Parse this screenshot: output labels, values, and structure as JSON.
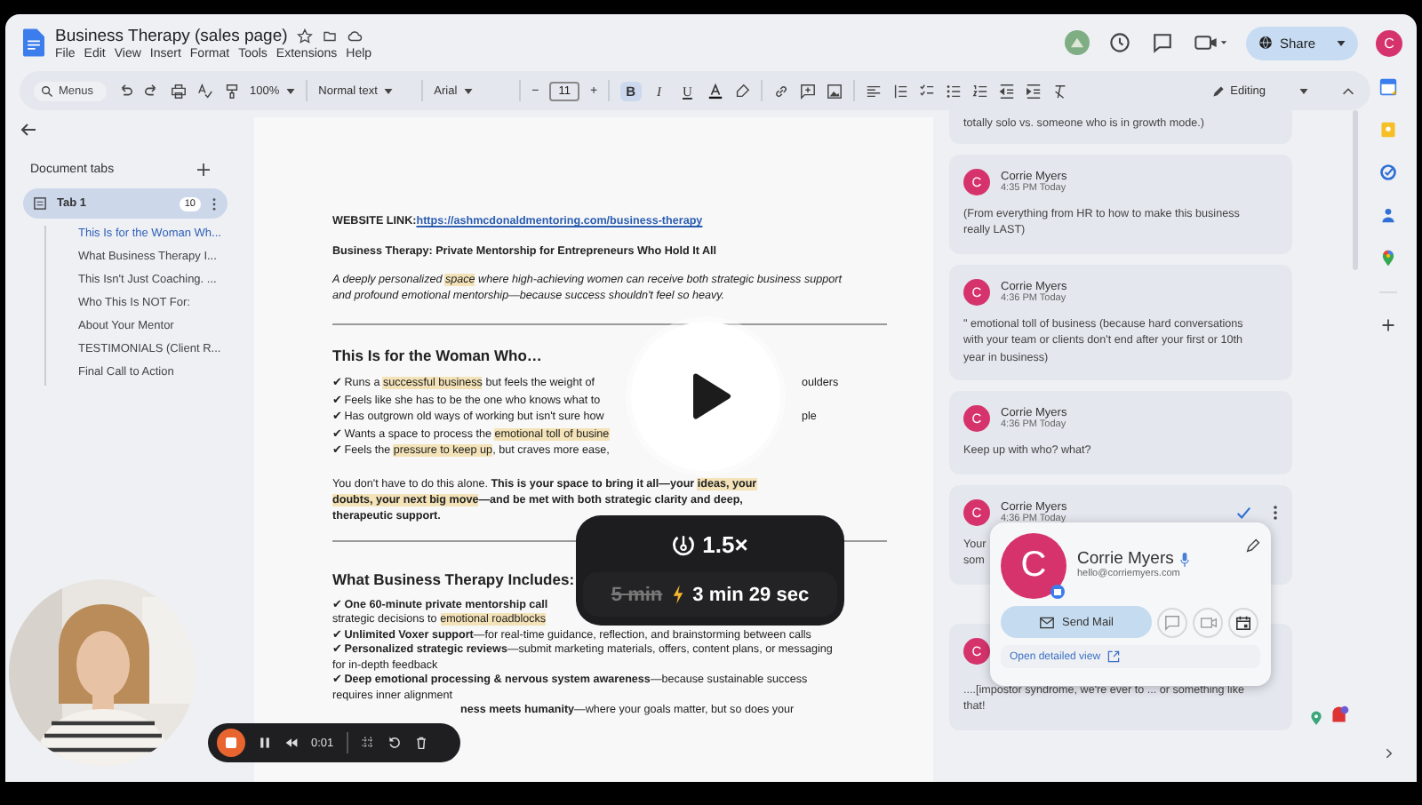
{
  "doc_title": "Business Therapy (sales page)",
  "menu": [
    "File",
    "Edit",
    "View",
    "Insert",
    "Format",
    "Tools",
    "Extensions",
    "Help"
  ],
  "share_label": "Share",
  "account_initial": "C",
  "toolbar": {
    "search": "Menus",
    "zoom": "100%",
    "style": "Normal text",
    "font": "Arial",
    "size_minus": "−",
    "size": "11",
    "size_plus": "+",
    "mode": "Editing"
  },
  "format_buttons": [
    {
      "label": "B",
      "selected": true
    },
    {
      "label": "I",
      "selected": false
    },
    {
      "label": "U",
      "selected": false
    }
  ],
  "sidebar": {
    "title": "Document tabs",
    "tab": {
      "label": "Tab 1",
      "count": "10",
      "selected": true
    },
    "outline": [
      {
        "label": "This Is for the Woman Wh...",
        "selected": true
      },
      {
        "label": "What Business Therapy I...",
        "selected": false
      },
      {
        "label": "This Isn't Just Coaching. ...",
        "selected": false
      },
      {
        "label": "Who This Is NOT For:",
        "selected": false
      },
      {
        "label": "About Your Mentor",
        "selected": false
      },
      {
        "label": "TESTIMONIALS (Client R...",
        "selected": false
      },
      {
        "label": "Final Call to Action",
        "selected": false
      }
    ]
  },
  "document": [
    {
      "kind": "link",
      "label": "WEBSITE LINK:",
      "url": "https://ashmcdonaldmentoring.com/business-therapy"
    },
    {
      "kind": "title",
      "parts": [
        {
          "text": "Business Therapy: Private Mentorship for Entrepreneurs Who Hold It All",
          "hl": false
        }
      ]
    },
    {
      "kind": "intro",
      "parts": [
        {
          "text": "A deeply personalized ",
          "hl": false
        },
        {
          "text": "space",
          "hl": true
        },
        {
          "text": " where high-achieving women can receive both strategic business support and profound emotional mentorship—because success shouldn't feel so heavy.",
          "hl": false
        }
      ]
    },
    {
      "kind": "rule"
    },
    {
      "kind": "heading",
      "parts": [
        {
          "text": "This Is for the Woman Who…",
          "hl": false
        }
      ]
    },
    {
      "kind": "split",
      "parts": [
        {
          "text": "✔ Runs a ",
          "hl": false
        },
        {
          "text": "successful business",
          "hl": true
        },
        {
          "text": " but feels the weight of",
          "hl": false
        }
      ],
      "right": "oulders"
    },
    {
      "kind": "split",
      "parts": [
        {
          "text": "✔ Feels like she has to be the one who knows what to",
          "hl": false
        }
      ]
    },
    {
      "kind": "split",
      "parts": [
        {
          "text": "✔ Has outgrown old ways of working but isn't sure how",
          "hl": false
        }
      ],
      "right": "ple"
    },
    {
      "kind": "split",
      "parts": [
        {
          "text": "✔ Wants a space to process the ",
          "hl": false
        },
        {
          "text": "emotional toll of busine",
          "hl": true
        }
      ]
    },
    {
      "kind": "split",
      "parts": [
        {
          "text": "✔ Feels the ",
          "hl": false
        },
        {
          "text": "pressure to keep up",
          "hl": true
        },
        {
          "text": ", but craves more ease,",
          "hl": false
        }
      ]
    },
    {
      "kind": "para",
      "parts": [
        {
          "text": "You don't have to do this alone. **This is your space to bring it all—your** ",
          "hl": false
        },
        {
          "text": "**ideas, your doubts, your next big move**",
          "hl": true
        },
        {
          "text": "**—and be met with both strategic clarity and deep, therapeutic support.**",
          "hl": false
        }
      ]
    },
    {
      "kind": "rule"
    },
    {
      "kind": "heading",
      "parts": [
        {
          "text": "What Business Therapy Includes:",
          "hl": false
        }
      ]
    },
    {
      "kind": "line",
      "parts": [
        {
          "text": "✔ **One 60-minute private mentorship call**",
          "hl": false
        }
      ]
    },
    {
      "kind": "line",
      "parts": [
        {
          "text": "strategic decisions to ",
          "hl": false
        },
        {
          "text": "emotional roadblocks",
          "hl": true
        }
      ]
    },
    {
      "kind": "line",
      "parts": [
        {
          "text": "✔ **Unlimited Voxer support**—for real-time guidance, reflection, and brainstorming between calls",
          "hl": false
        }
      ]
    },
    {
      "kind": "line",
      "parts": [
        {
          "text": "✔ **Personalized strategic reviews**—submit marketing materials, offers, content plans, or messaging for in-depth feedback",
          "hl": false
        }
      ]
    },
    {
      "kind": "line",
      "parts": [
        {
          "text": "✔ **Deep emotional processing & nervous system awareness**—because sustainable success requires inner alignment",
          "hl": false
        }
      ]
    },
    {
      "kind": "tail",
      "parts": [
        {
          "text": "**ness meets humanity**—where your goals matter, but so does your",
          "hl": false
        }
      ]
    }
  ],
  "comments": [
    {
      "kind": "plain",
      "text": "totally solo vs. someone who is in growth mode.)"
    },
    {
      "kind": "plain",
      "avatar": "C",
      "author": "Corrie Myers",
      "time": "4:35 PM Today",
      "text": "(From everything from HR to how to make this business really LAST)"
    },
    {
      "kind": "plain",
      "avatar": "C",
      "author": "Corrie Myers",
      "time": "4:36 PM Today",
      "text": "\" emotional toll of business (because hard conversations with your team or clients don't end after your first or 10th year in business)"
    },
    {
      "kind": "plain",
      "avatar": "C",
      "author": "Corrie Myers",
      "time": "4:36 PM Today",
      "text": "Keep up with who? what?"
    },
    {
      "kind": "active",
      "avatar": "C",
      "author": "Corrie Myers",
      "time": "4:36 PM Today",
      "text": "Your som"
    },
    {
      "kind": "plain",
      "avatar": "C",
      "text": "....[impostor syndrome, we're ever to ... or something like that!"
    }
  ],
  "profile_card": {
    "initial": "C",
    "name": "Corrie Myers",
    "email": "hello@corriemyers.com",
    "send": "Send Mail",
    "details": "Open detailed view"
  },
  "speed": {
    "rate": "1.5×",
    "old": "5 min",
    "new": "3 min 29 sec"
  },
  "recorder": {
    "time": "0:01"
  }
}
